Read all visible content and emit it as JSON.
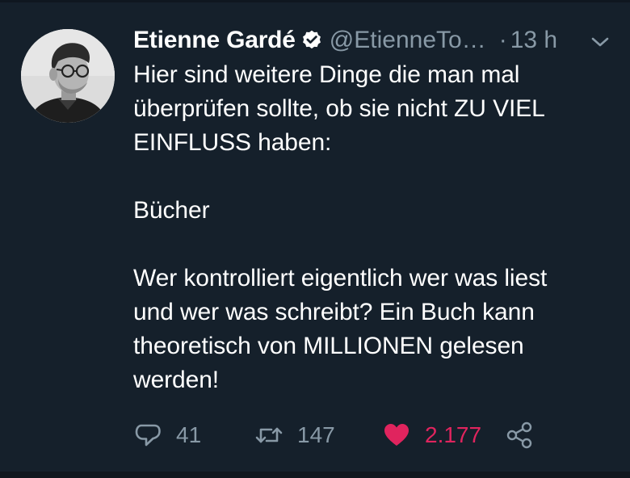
{
  "tweet": {
    "author": {
      "name": "Etienne Gardé",
      "handle": "@EtienneTo…",
      "verified": true
    },
    "separator": "·",
    "time": "13 h",
    "body": {
      "paragraph1_line1": "Hier sind weitere Dinge die man mal",
      "paragraph1_line2": "überprüfen sollte, ob sie nicht ZU VIEL",
      "paragraph1_line3": "EINFLUSS haben:",
      "paragraph2": "Bücher",
      "paragraph3_line1": "Wer kontrolliert eigentlich wer was liest",
      "paragraph3_line2": "und wer was schreibt? Ein Buch kann",
      "paragraph3_line3": "theoretisch von MILLIONEN gelesen",
      "paragraph3_line4": "werden!"
    },
    "actions": {
      "replies": "41",
      "retweets": "147",
      "likes": "2.177"
    }
  },
  "icons": {
    "verified": "verified-badge-icon",
    "more": "chevron-down-icon",
    "reply": "reply-bubble-icon",
    "retweet": "retweet-icon",
    "like": "heart-icon",
    "share": "share-icon"
  },
  "colors": {
    "background": "#15202b",
    "text": "#ffffff",
    "secondary_text": "#8899a6",
    "like": "#e0245e"
  }
}
